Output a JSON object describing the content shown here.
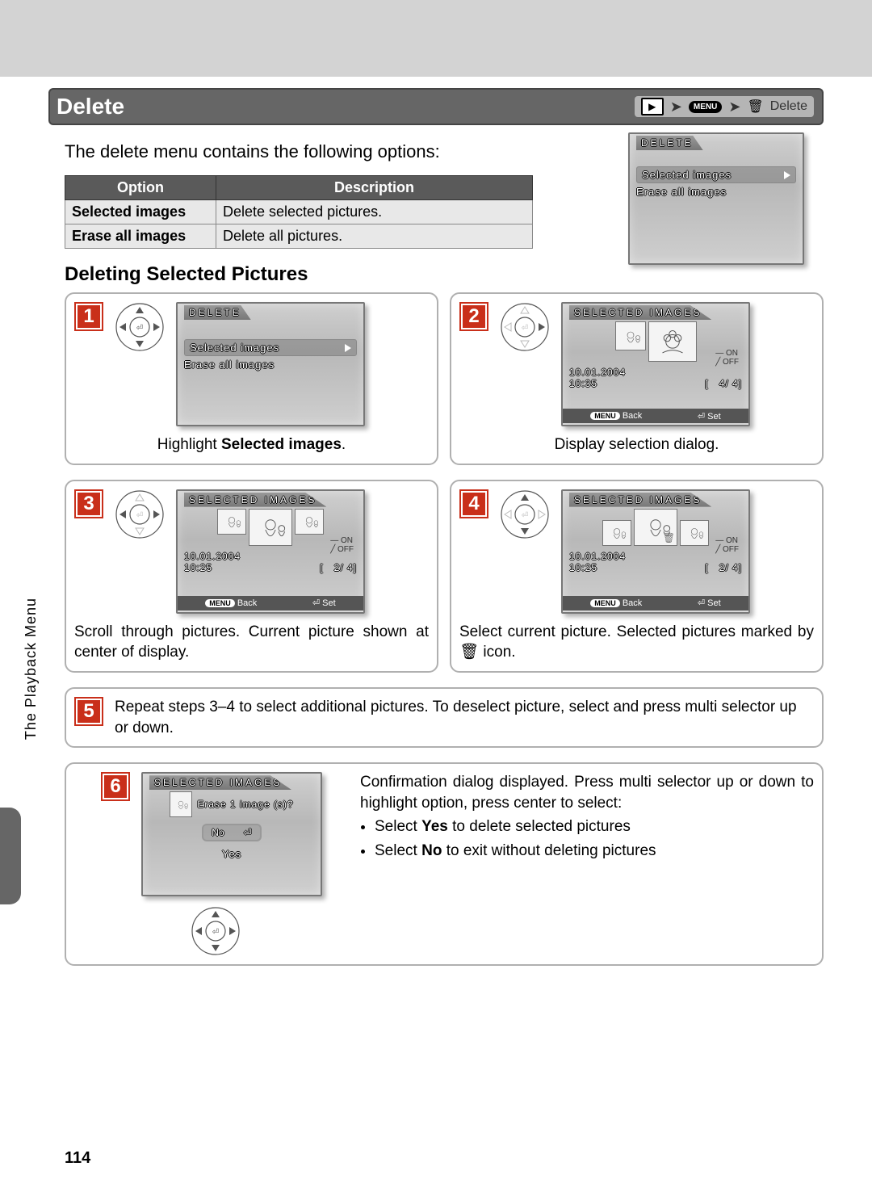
{
  "title": "Delete",
  "breadcrumb": {
    "menu": "MENU",
    "label": "Delete"
  },
  "intro": "The delete menu contains the following options:",
  "table": {
    "h1": "Option",
    "h2": "Description",
    "r1o": "Selected images",
    "r1d": "Delete selected pictures.",
    "r2o": "Erase all images",
    "r2d": "Delete all pictures."
  },
  "mini": {
    "title": "DELETE",
    "opt1": "Selected images",
    "opt2": "Erase all images"
  },
  "subheading": "Deleting Selected Pictures",
  "s1": {
    "screenTitle": "DELETE",
    "opt1": "Selected images",
    "opt2": "Erase all images",
    "caption_a": "Highlight ",
    "caption_b": "Selected images",
    "caption_c": "."
  },
  "s2": {
    "screenTitle": "SELECTED IMAGES",
    "on": "ON",
    "off": "OFF",
    "date": "10.01.2004",
    "time": "10:35",
    "count": "4/   4]",
    "back": "Back",
    "set": "Set",
    "menu": "MENU",
    "caption": "Display selection dialog."
  },
  "s3": {
    "screenTitle": "SELECTED IMAGES",
    "on": "ON",
    "off": "OFF",
    "date": "10.01.2004",
    "time": "10:25",
    "count": "2/   4]",
    "back": "Back",
    "set": "Set",
    "menu": "MENU",
    "caption": "Scroll through pictures.  Current pic­ture shown at center of display."
  },
  "s4": {
    "screenTitle": "SELECTED IMAGES",
    "on": "ON",
    "off": "OFF",
    "date": "10.01.2004",
    "time": "10:25",
    "count": "2/   4]",
    "back": "Back",
    "set": "Set",
    "menu": "MENU",
    "trash": "🗑",
    "caption_a": "Select current picture.  Selected pic­tures marked by ",
    "caption_b": " icon."
  },
  "s5": "Repeat steps 3–4 to select additional pictures.  To deselect picture, select and press multi selector up or down.",
  "s6": {
    "screenTitle": "SELECTED IMAGES",
    "prompt": "Erase 1 image (s)?",
    "no": "No",
    "yes": "Yes",
    "rt1": "Confirmation dialog displayed.  Press multi selector up or down to highlight option, press center to select:",
    "li1a": "Select ",
    "li1b": "Yes",
    "li1c": " to delete selected pictures",
    "li2a": "Select ",
    "li2b": "No",
    "li2c": " to exit without deleting pictures"
  },
  "sideTab": "The Playback Menu",
  "pageNum": "114"
}
